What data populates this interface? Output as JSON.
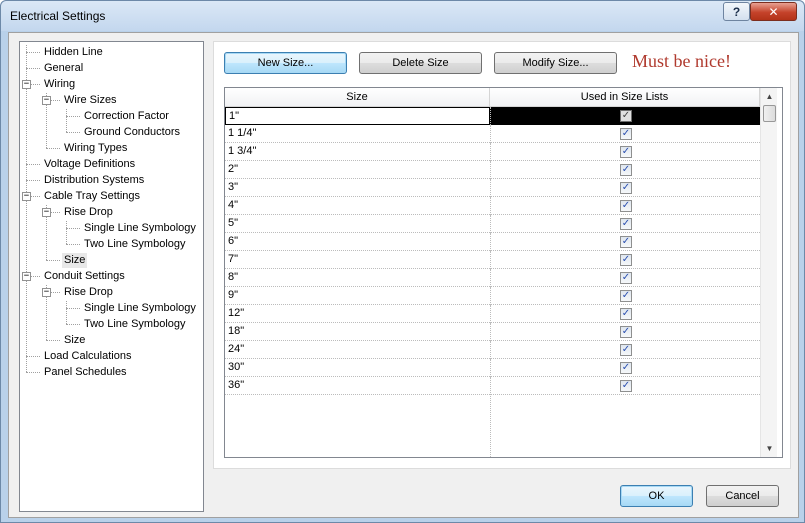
{
  "window": {
    "title": "Electrical Settings"
  },
  "title_buttons": {
    "help": "?",
    "close": "✕"
  },
  "tree": {
    "items": [
      {
        "label": "Hidden Line",
        "level": 1
      },
      {
        "label": "General",
        "level": 1
      },
      {
        "label": "Wiring",
        "level": 1,
        "expander": "−"
      },
      {
        "label": "Wire Sizes",
        "level": 2,
        "expander": "−"
      },
      {
        "label": "Correction Factor",
        "level": 3
      },
      {
        "label": "Ground Conductors",
        "level": 3
      },
      {
        "label": "Wiring Types",
        "level": 2
      },
      {
        "label": "Voltage Definitions",
        "level": 1
      },
      {
        "label": "Distribution Systems",
        "level": 1
      },
      {
        "label": "Cable Tray Settings",
        "level": 1,
        "expander": "−"
      },
      {
        "label": "Rise Drop",
        "level": 2,
        "expander": "−"
      },
      {
        "label": "Single Line Symbology",
        "level": 3
      },
      {
        "label": "Two Line Symbology",
        "level": 3
      },
      {
        "label": "Size",
        "level": 2,
        "selected": true
      },
      {
        "label": "Conduit Settings",
        "level": 1,
        "expander": "−"
      },
      {
        "label": "Rise Drop",
        "level": 2,
        "expander": "−"
      },
      {
        "label": "Single Line Symbology",
        "level": 3
      },
      {
        "label": "Two Line Symbology",
        "level": 3
      },
      {
        "label": "Size",
        "level": 2
      },
      {
        "label": "Load Calculations",
        "level": 1
      },
      {
        "label": "Panel Schedules",
        "level": 1
      }
    ]
  },
  "toolbar": {
    "new_size": "New Size...",
    "delete_size": "Delete Size",
    "modify_size": "Modify Size...",
    "note": "Must be nice!"
  },
  "grid": {
    "columns": [
      "Size",
      "Used in Size Lists"
    ],
    "rows": [
      {
        "size": "1\"",
        "used": true,
        "active": true
      },
      {
        "size": "1 1/4\"",
        "used": true
      },
      {
        "size": "1 3/4\"",
        "used": true
      },
      {
        "size": "2\"",
        "used": true
      },
      {
        "size": "3\"",
        "used": true
      },
      {
        "size": "4\"",
        "used": true
      },
      {
        "size": "5\"",
        "used": true
      },
      {
        "size": "6\"",
        "used": true
      },
      {
        "size": "7\"",
        "used": true
      },
      {
        "size": "8\"",
        "used": true
      },
      {
        "size": "9\"",
        "used": true
      },
      {
        "size": "12\"",
        "used": true
      },
      {
        "size": "18\"",
        "used": true
      },
      {
        "size": "24\"",
        "used": true
      },
      {
        "size": "30\"",
        "used": true
      },
      {
        "size": "36\"",
        "used": true
      }
    ],
    "check_glyph": "✓"
  },
  "footer": {
    "ok": "OK",
    "cancel": "Cancel"
  }
}
